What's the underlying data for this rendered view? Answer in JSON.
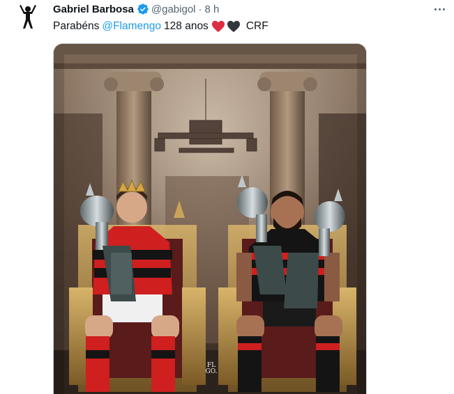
{
  "tweet": {
    "author_name": "Gabriel Barbosa",
    "handle": "@gabigol",
    "separator": "·",
    "time": "8 h",
    "text_before": "Parabéns",
    "mention": "@Flamengo",
    "text_middle": "128 anos",
    "text_after": "CRF",
    "heart_colors": [
      "#f91880",
      "#2f3336"
    ],
    "verified_color": "#1d9bf0",
    "media": {
      "watermark": "FL GO.",
      "description_icons": [
        "crown",
        "trophy",
        "throne"
      ]
    }
  },
  "icons": {
    "avatar": "silhouette-avatar-icon",
    "verified": "verified-badge-icon",
    "more": "more-options-icon"
  }
}
